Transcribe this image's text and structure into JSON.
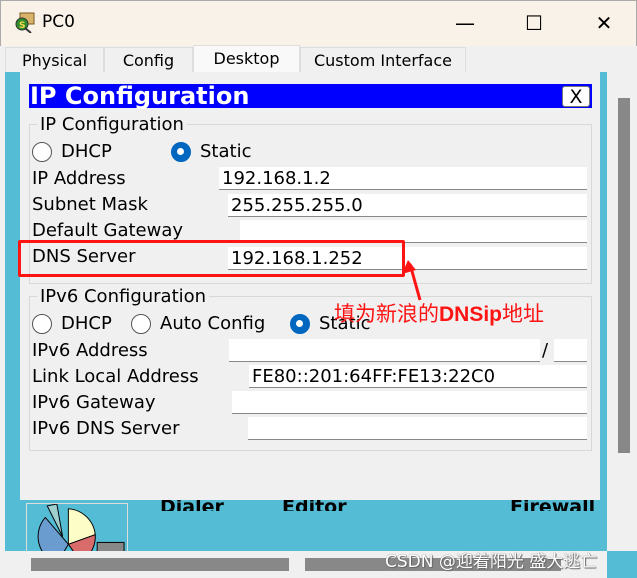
{
  "window": {
    "title": "PC0",
    "minimize": "—",
    "maximize": "☐",
    "close": "✕"
  },
  "tabs": [
    {
      "label": "Physical"
    },
    {
      "label": "Config"
    },
    {
      "label": "Desktop",
      "active": true
    },
    {
      "label": "Custom Interface"
    }
  ],
  "dialog": {
    "title": "IP Configuration",
    "close_label": "X",
    "ipv4": {
      "legend": "IP Configuration",
      "mode_dhcp": "DHCP",
      "mode_static": "Static",
      "selected": "Static",
      "ip_address_label": "IP Address",
      "ip_address": "192.168.1.2",
      "subnet_mask_label": "Subnet Mask",
      "subnet_mask": "255.255.255.0",
      "gateway_label": "Default Gateway",
      "gateway": "",
      "dns_label": "DNS Server",
      "dns": "192.168.1.252"
    },
    "ipv6": {
      "legend": "IPv6 Configuration",
      "mode_dhcp": "DHCP",
      "mode_auto": "Auto Config",
      "mode_static": "Static",
      "selected": "Static",
      "address_label": "IPv6 Address",
      "address": "",
      "slash": "/",
      "prefix": "",
      "link_local_label": "Link Local Address",
      "link_local": "FE80::201:64FF:FE13:22C0",
      "gateway_label": "IPv6 Gateway",
      "gateway": "",
      "dns_label": "IPv6 DNS Server",
      "dns": ""
    }
  },
  "annotation": {
    "text_a": "填为新浪的",
    "text_b": "DNSip",
    "text_c": "地址",
    "color": "#ff1414"
  },
  "desktop_apps": [
    {
      "label": "Dialer"
    },
    {
      "label": "Editor"
    },
    {
      "label": "Firewall"
    }
  ],
  "watermark": "CSDN @迎着阳光 盛大逃亡",
  "colors": {
    "desktop_bg": "#54bcd4",
    "dialog_title_bg": "#0000ff",
    "highlight": "#ff1414"
  }
}
